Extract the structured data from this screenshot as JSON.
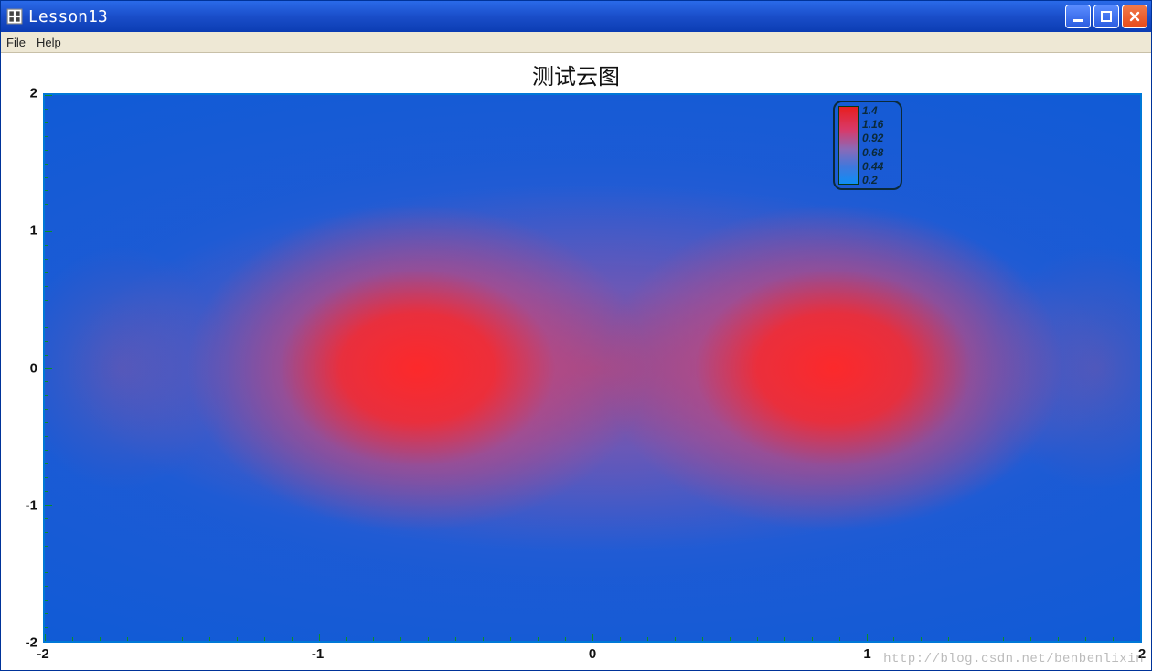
{
  "window": {
    "title": "Lesson13"
  },
  "menubar": {
    "file": "File",
    "help": "Help"
  },
  "chart_data": {
    "type": "heatmap",
    "title": "测试云图",
    "xlabel": "",
    "ylabel": "",
    "xlim": [
      -2,
      2
    ],
    "ylim": [
      -2,
      2
    ],
    "xticks": [
      -2,
      -1,
      0,
      1,
      2
    ],
    "yticks": [
      -2,
      -1,
      0,
      1,
      2
    ],
    "colorbar": {
      "position": "top-right-inset",
      "labels": [
        1.4,
        1.16,
        0.92,
        0.68,
        0.44,
        0.2
      ],
      "min": 0.2,
      "max": 1.4,
      "cmap_low": "#0f8df5",
      "cmap_high": "#e81e1e"
    },
    "description": "Density/contour plot of a scalar field on x∈[-2,2], y∈[-2,2]. Two high-value lobes (~1.4) centered near (x≈-0.9, y≈0) and (x≈0.9, y≈0), merging along y=0 into an elongated warm band; field falls toward ~0.2 at the top/bottom edges.",
    "peaks": [
      {
        "x": -0.9,
        "y": 0.0,
        "value": 1.4
      },
      {
        "x": 0.9,
        "y": 0.0,
        "value": 1.4
      }
    ],
    "edge_value_top_bottom": 0.2
  },
  "watermark": "http://blog.csdn.net/benbenlixin"
}
